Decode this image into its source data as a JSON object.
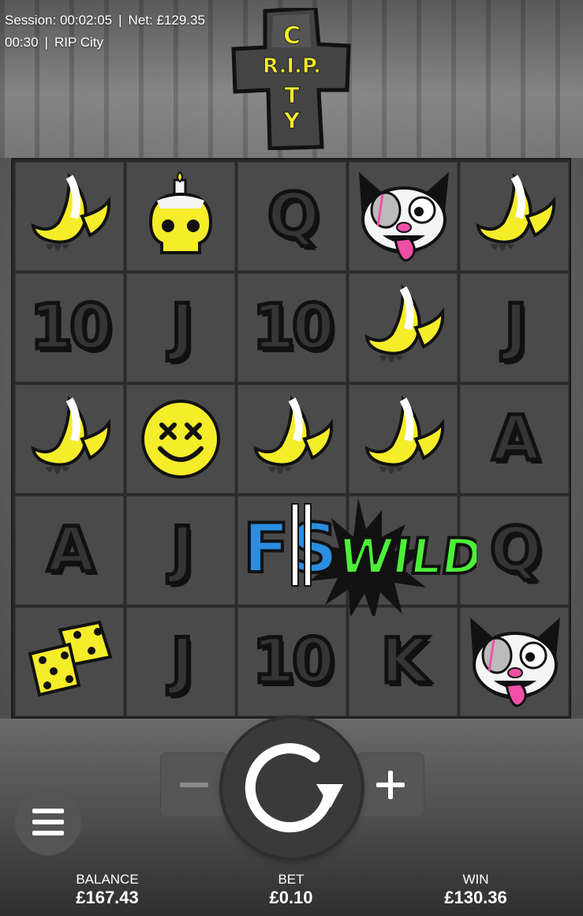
{
  "session": {
    "session_label": "Session:",
    "session_time": "00:02:05",
    "net_label": "Net:",
    "net_value": "£129.35",
    "clock": "00:30",
    "game_name": "RIP City"
  },
  "logo": {
    "text_vertical": "CITY",
    "text_horizontal": "R.I.P."
  },
  "grid": {
    "rows": [
      [
        "banana",
        "skull-candle",
        "Q",
        "cat",
        "banana"
      ],
      [
        "10",
        "J",
        "10",
        "banana",
        "J"
      ],
      [
        "banana",
        "smiley",
        "banana",
        "banana",
        "A"
      ],
      [
        "A",
        "J",
        "fs",
        "wild",
        "Q"
      ],
      [
        "dice",
        "J",
        "10",
        "K",
        "cat"
      ]
    ],
    "wild_label": "WILD",
    "fs_label": "FS"
  },
  "controls": {
    "minus_label": "−",
    "plus_label": "+",
    "spin_icon": "spin-icon",
    "menu_icon": "hamburger-icon"
  },
  "stats": {
    "balance_label": "BALANCE",
    "balance_value": "£167.43",
    "bet_label": "BET",
    "bet_value": "£0.10",
    "win_label": "WIN",
    "win_value": "£130.36"
  },
  "colors": {
    "yellow": "#f5ec2a",
    "wild_green": "#4df038",
    "fs_blue": "#2a8ee0",
    "pink": "#f04fa8"
  }
}
